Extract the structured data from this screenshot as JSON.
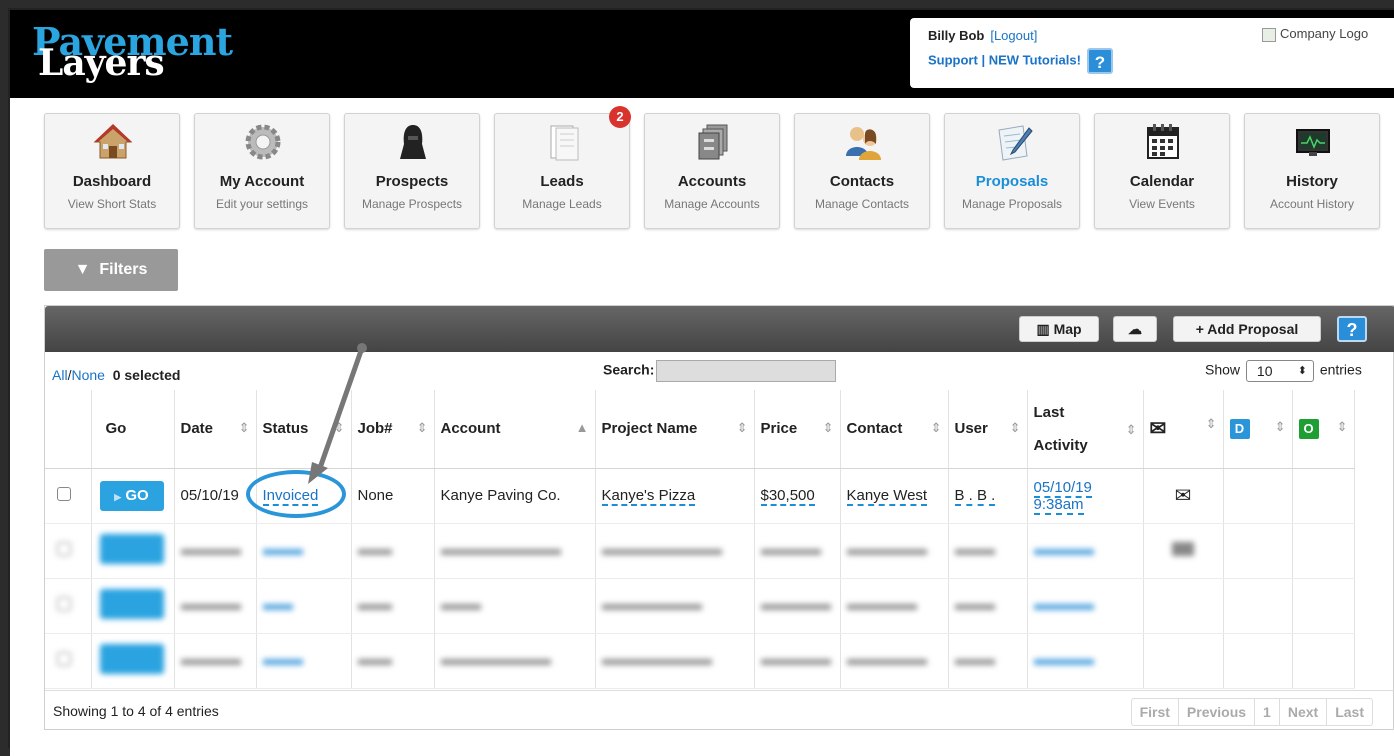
{
  "header": {
    "logo_line1": "Pavement",
    "logo_line2": "Layers",
    "user_name": "Billy Bob",
    "logout": "[Logout]",
    "support": "Support",
    "separator": "|",
    "tutorials": "NEW Tutorials!",
    "help": "?",
    "company_logo_alt": "Company Logo"
  },
  "nav": [
    {
      "title": "Dashboard",
      "sub": "View Short Stats",
      "icon": "house-icon"
    },
    {
      "title": "My Account",
      "sub": "Edit your settings",
      "icon": "gear-icon"
    },
    {
      "title": "Prospects",
      "sub": "Manage Prospects",
      "icon": "person-hood-icon"
    },
    {
      "title": "Leads",
      "sub": "Manage Leads",
      "icon": "documents-icon",
      "badge": "2"
    },
    {
      "title": "Accounts",
      "sub": "Manage Accounts",
      "icon": "file-cabinet-icon"
    },
    {
      "title": "Contacts",
      "sub": "Manage Contacts",
      "icon": "people-icon"
    },
    {
      "title": "Proposals",
      "sub": "Manage Proposals",
      "icon": "pen-paper-icon"
    },
    {
      "title": "Calendar",
      "sub": "View Events",
      "icon": "calendar-icon"
    },
    {
      "title": "History",
      "sub": "Account History",
      "icon": "monitor-icon"
    }
  ],
  "filters_label": "Filters",
  "toolbar": {
    "map": "Map",
    "add": "+ Add Proposal",
    "help": "?"
  },
  "selection": {
    "all": "All",
    "slash": "/",
    "none": "None",
    "count": "0 selected"
  },
  "search_label": "Search:",
  "show": {
    "prefix": "Show",
    "value": "10",
    "suffix": "entries"
  },
  "columns": [
    "Go",
    "Date",
    "Status",
    "Job#",
    "Account",
    "Project Name",
    "Price",
    "Contact",
    "User",
    "Last Activity",
    "D",
    "O"
  ],
  "rows": [
    {
      "go": "GO",
      "date": "05/10/19",
      "status": "Invoiced",
      "job": "None",
      "account": "Kanye Paving Co.",
      "project": "Kanye's Pizza",
      "price": "$30,500",
      "contact": "Kanye West",
      "user": "B . B .",
      "activity_date": "05/10/19",
      "activity_time": "9:38am"
    }
  ],
  "footer": {
    "info": "Showing 1 to 4 of 4 entries",
    "first": "First",
    "previous": "Previous",
    "page": "1",
    "next": "Next",
    "last": "Last"
  },
  "colors": {
    "accent": "#2aa3e0",
    "badge": "#d9332d",
    "d_badge": "#2a95d8",
    "o_badge": "#1e9e33",
    "annotation": "#2a95d8"
  }
}
